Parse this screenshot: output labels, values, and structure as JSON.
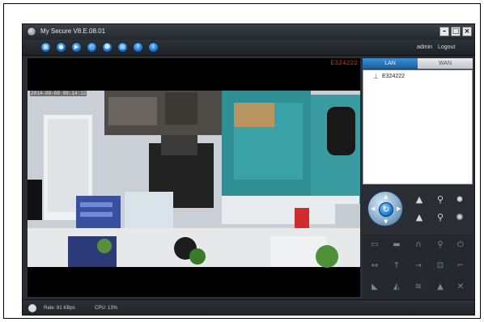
{
  "window": {
    "title": "My Secure  V8.E.08.01",
    "controls": {
      "minimize": "–",
      "maximize": "□",
      "close": "×"
    }
  },
  "toolbar": {
    "buttons": [
      {
        "icon": "grid-view-icon"
      },
      {
        "icon": "record-icon"
      },
      {
        "icon": "playback-icon"
      },
      {
        "icon": "search-device-icon"
      },
      {
        "icon": "user-icon"
      },
      {
        "icon": "settings-icon"
      },
      {
        "icon": "help-icon"
      },
      {
        "icon": "info-icon"
      }
    ],
    "user": "admin",
    "logout": "Logout"
  },
  "video": {
    "camera_name": "E324222",
    "timestamp": "2014-09-09 09:14:12"
  },
  "panel": {
    "tabs": [
      {
        "label": "LAN",
        "active": true
      },
      {
        "label": "WAN",
        "active": false
      }
    ],
    "devices": [
      {
        "name": "E324222",
        "icon": "camera-icon"
      }
    ]
  },
  "ptz": {
    "buttons": [
      {
        "icon": "zoom-in-icon"
      },
      {
        "icon": "zoom-out-icon"
      },
      {
        "icon": "focus-near-icon"
      },
      {
        "icon": "focus-far-icon"
      },
      {
        "icon": "iris-open-icon"
      },
      {
        "icon": "iris-close-icon"
      }
    ]
  },
  "controls": {
    "icons": [
      "folder-icon",
      "snapshot-icon",
      "headphone-icon",
      "microphone-icon",
      "power-icon",
      "flip-horizontal-icon",
      "flip-vertical-icon",
      "arrow-right-icon",
      "preset-icon",
      "corner-icon",
      "ir-light-icon",
      "alarm-icon",
      "wifi-icon",
      "warning-icon",
      "tools-icon"
    ]
  },
  "status": {
    "rate": "Rate: 81 KBps",
    "cpu": "CPU:  13%"
  },
  "colors": {
    "accent": "#1f7fd4",
    "alert": "#e02020",
    "chrome": "#2a2e34"
  }
}
